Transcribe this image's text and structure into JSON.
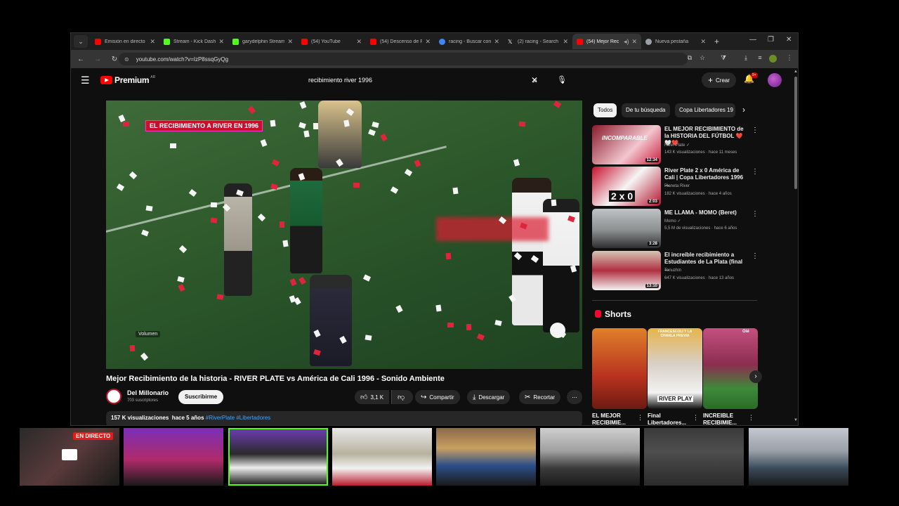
{
  "browser": {
    "tabs": [
      {
        "title": "Emisión en directo",
        "color": "#ff0000"
      },
      {
        "title": "Stream - Kick Dashb",
        "color": "#53fc18"
      },
      {
        "title": "garydelphin Stream",
        "color": "#53fc18"
      },
      {
        "title": "(54) YouTube",
        "color": "#ff0000"
      },
      {
        "title": "(54) Descenso de R",
        "color": "#ff0000"
      },
      {
        "title": "racing - Buscar con",
        "color": "#4285f4"
      },
      {
        "title": "(2) racing - Search /",
        "color": "#ffffff"
      },
      {
        "title": "(54) Mejor Rec",
        "color": "#ff0000"
      },
      {
        "title": "Nueva pestaña",
        "color": "#9aa0a6"
      }
    ],
    "url": "youtube.com/watch?v=IzP8ssqGyQg"
  },
  "youtube": {
    "logo_text": "Premium",
    "logo_country": "AR",
    "search_value": "recibimiento river 1996",
    "create_label": "Crear",
    "notifications_badge": "9+"
  },
  "video": {
    "banner": "EL RECIBIMIENTO A RIVER EN 1996",
    "volume_label": "Volumen",
    "title": "Mejor Recibimiento de la historia - RIVER PLATE vs América de Cali 1996 - Sonido Ambiente",
    "channel": "Del Millonario",
    "subscribers": "703 suscriptores",
    "subscribe_label": "Suscribirme",
    "likes": "3,1 K",
    "share_label": "Compartir",
    "download_label": "Descargar",
    "clip_label": "Recortar",
    "views": "157 K visualizaciones",
    "age": "hace 5 años",
    "tags": "#RiverPlate #Libertadores"
  },
  "sidebar": {
    "chips": [
      "Todos",
      "De tu búsqueda",
      "Copa Libertadores 19"
    ],
    "recommendations": [
      {
        "title": "EL MEJOR RECIBIMIENTO de la HISTORIA DEL FÚTBOL ❤️🤍❤️",
        "channel": "River Plate",
        "views": "143 K visualizaciones · hace 11 meses",
        "duration": "12:34",
        "thumb_text": "INCOMPARABLE"
      },
      {
        "title": "River Plate 2 x 0 América de Cali | Copa Libertadores 1996 ...",
        "channel": "Planeta River",
        "views": "182 K visualizaciones · hace 4 años",
        "duration": "2:03",
        "thumb_text": "2 x 0"
      },
      {
        "title": "ME LLAMA - MOMO (Beret)",
        "channel": "Momo",
        "views": "5,5 M de visualizaciones · hace 6 años",
        "duration": "3:28",
        "thumb_text": ""
      },
      {
        "title": "El increíble recibimiento a Estudiantes de La Plata (final ...",
        "channel": "Tenuzhin",
        "views": "647 K visualizaciones · hace 13 años",
        "duration": "13:10",
        "thumb_text": ""
      }
    ],
    "shorts_title": "Shorts",
    "shorts": [
      {
        "caption": "EL MEJOR RECIBIMIE...",
        "overlay": ""
      },
      {
        "caption": "Final Libertadores...",
        "overlay": "FRANCESCOLI Y LA CHARLA PREVIA"
      },
      {
        "caption": "INCREIBLE RECIBIMIE...",
        "overlay": "Olé"
      }
    ],
    "shorts_overlay_brand": "RIVER PLAY"
  },
  "stream": {
    "live_badge": "EN DIRECTO"
  }
}
